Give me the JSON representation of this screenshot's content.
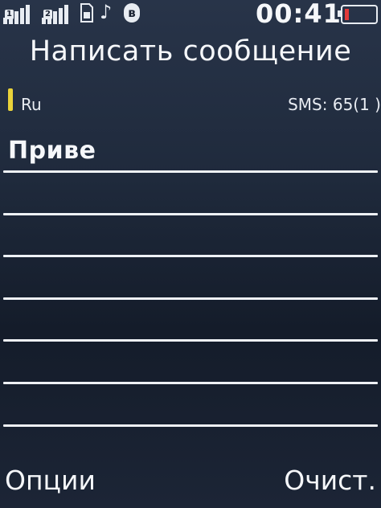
{
  "status_bar": {
    "sim1_badge": "1",
    "sim2_badge": "2",
    "sim_card_icon": "sim-card-icon",
    "music_icon": "music-note-icon",
    "bluetooth_icon": "bluetooth-icon",
    "bluetooth_glyph": "ʙ",
    "time": "00:41",
    "battery_icon": "battery-low-icon",
    "battery_color": "#e23a3a",
    "battery_level": 0.15
  },
  "screen": {
    "title": "Написать сообщение",
    "input_language": "Ru",
    "sms_counter": "SMS: 65(1 )"
  },
  "compose": {
    "text": "Приве"
  },
  "softkeys": {
    "left": "Опции",
    "right": "Очист."
  }
}
